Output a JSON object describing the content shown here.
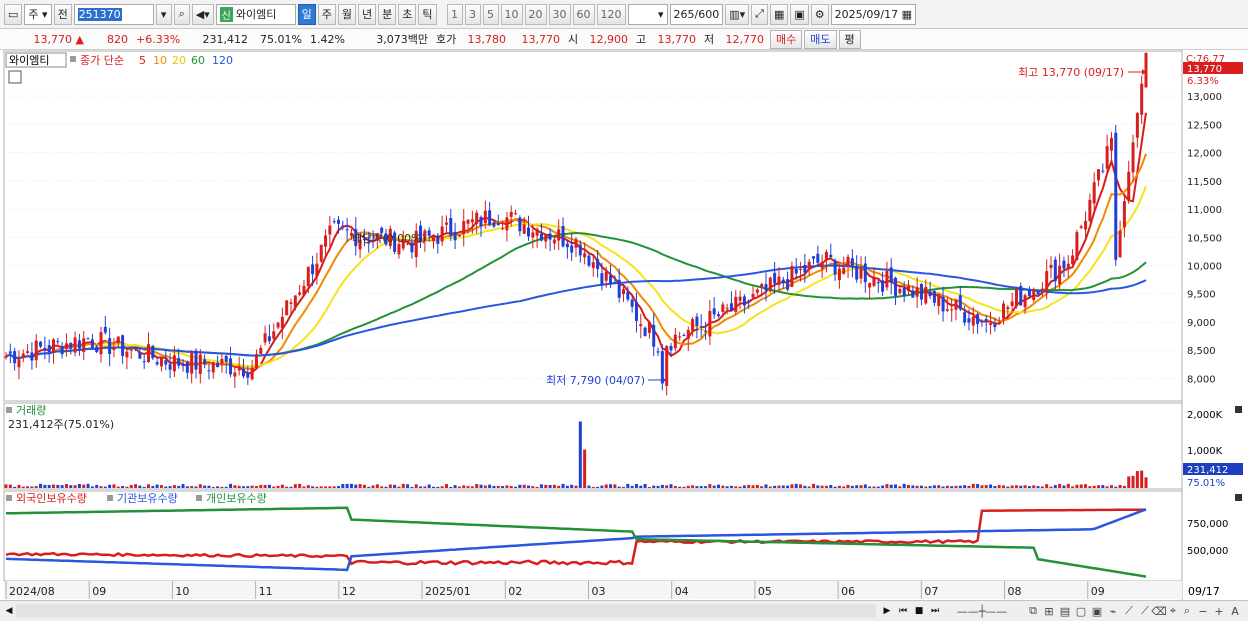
{
  "toolbar": {
    "type_select": "주",
    "prev_label": "전",
    "stock_code": "251370",
    "new_badge": "신",
    "stock_name": "와이엠티",
    "periods": [
      "일",
      "주",
      "월",
      "년",
      "분",
      "초",
      "틱"
    ],
    "active_period": "일",
    "intervals": [
      "1",
      "3",
      "5",
      "10",
      "20",
      "30",
      "60",
      "120"
    ],
    "count_label": "265",
    "count_max": "/600",
    "date": "2025/09/17"
  },
  "quote": {
    "price": "13,770",
    "arrow": "▲",
    "change": "820",
    "change_pct": "+6.33%",
    "volume": "231,412",
    "volume_ratio": "75.01%",
    "turnover": "1.42%",
    "amount": "3,073백만",
    "bid_label": "호가",
    "bid1": "13,780",
    "bid2": "13,770",
    "open_label": "시",
    "open": "12,900",
    "high_label": "고",
    "high": "13,770",
    "low_label": "저",
    "low": "12,770",
    "buy_label": "매수",
    "sell_label": "매도",
    "eval_label": "평"
  },
  "price_panel": {
    "stock_tag": "와이엠티",
    "legend_title": "종가 단순",
    "ma_labels": [
      "5",
      "10",
      "20",
      "60",
      "120"
    ],
    "ma_colors": [
      "#dd1a1a",
      "#f08a00",
      "#f5e31c",
      "#239138",
      "#2a56e0"
    ],
    "yticks": [
      "13,000",
      "12,500",
      "12,000",
      "11,500",
      "11,000",
      "10,500",
      "10,000",
      "9,500",
      "9,000",
      "8,500",
      "8,000"
    ],
    "top_label": "C:76.77",
    "price_tag": "13,770",
    "pct_tag": "6.33%",
    "high_annotation": "최고 13,770 (09/17)",
    "low_annotation": "최저 7,790 (04/07)",
    "dividend_annotation": "배당락(0.00%)"
  },
  "volume_panel": {
    "title": "거래량",
    "sub": "231,412주(75.01%)",
    "yticks": [
      "2,000K",
      "1,000K"
    ],
    "tag": "231,412",
    "tag_pct": "75.01%"
  },
  "holdings_panel": {
    "legend": [
      "외국인보유수량",
      "기관보유수량",
      "개인보유수량"
    ],
    "yticks": [
      "750,000",
      "500,000"
    ]
  },
  "xaxis": {
    "labels": [
      "2024/08",
      "09",
      "10",
      "11",
      "12",
      "2025/01",
      "02",
      "03",
      "04",
      "05",
      "06",
      "07",
      "08",
      "09"
    ],
    "last_label": "09/17"
  },
  "chart_data": {
    "type": "candlestick",
    "range": "2024/08 - 2025/09/17",
    "ylim": [
      7600,
      13800
    ],
    "last_close": 13770,
    "high": {
      "value": 13770,
      "date": "09/17"
    },
    "low": {
      "value": 7790,
      "date": "04/07"
    },
    "monthly_close_approx": {
      "months": [
        "2024/08",
        "09",
        "10",
        "11",
        "12",
        "2025/01",
        "02",
        "03",
        "04",
        "05",
        "06",
        "07",
        "08",
        "09"
      ],
      "values": [
        8400,
        8700,
        8300,
        8200,
        10600,
        10400,
        10900,
        10400,
        8600,
        9300,
        10100,
        9600,
        9000,
        10100
      ]
    },
    "ma60_end": 9900,
    "ma120_end": 9600
  }
}
